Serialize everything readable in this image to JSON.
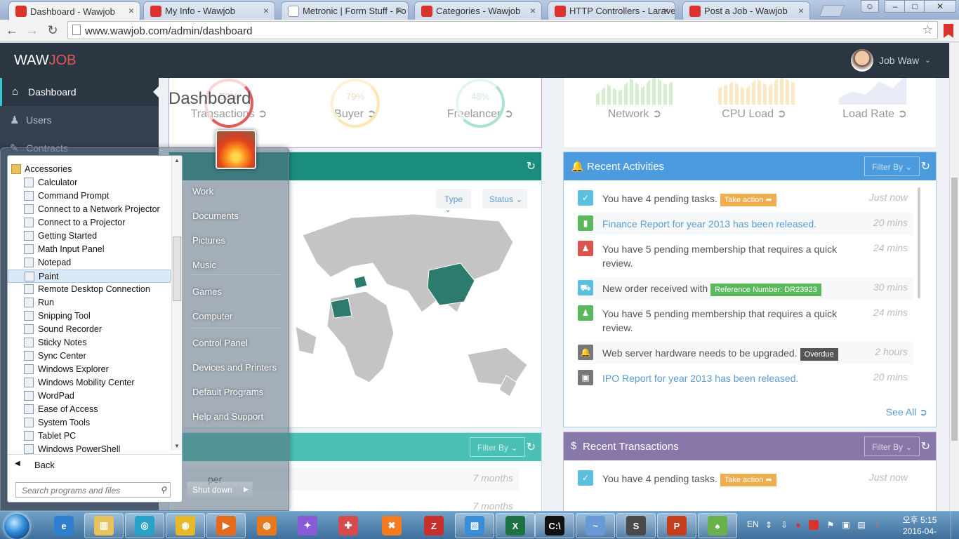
{
  "browser": {
    "tabs": [
      {
        "title": "Dashboard - Wawjob",
        "active": true
      },
      {
        "title": "My Info - Wawjob",
        "active": false
      },
      {
        "title": "Metronic | Form Stuff - Fo",
        "active": false
      },
      {
        "title": "Categories - Wawjob",
        "active": false
      },
      {
        "title": "HTTP Controllers - Laravel",
        "active": false
      },
      {
        "title": "Post a Job - Wawjob",
        "active": false
      }
    ],
    "url": "www.wawjob.com/admin/dashboard"
  },
  "app": {
    "logo_main": "WAW",
    "logo_accent": "JOB",
    "user_name": "Job Waw",
    "page_title": "Dashboard"
  },
  "sidebar": {
    "items": [
      {
        "label": "Dashboard",
        "icon": "home-icon",
        "active": true
      },
      {
        "label": "Users",
        "icon": "users-icon",
        "active": false
      },
      {
        "label": "Contracts",
        "icon": "contracts-icon",
        "active": false
      }
    ]
  },
  "stats_left": {
    "items": [
      {
        "value": "52%",
        "label": "Transactions"
      },
      {
        "value": "79%",
        "label": "Buyer"
      },
      {
        "value": "48%",
        "label": "Freelancer"
      }
    ]
  },
  "stats_right": {
    "items": [
      {
        "label": "Network"
      },
      {
        "label": "CPU Load"
      },
      {
        "label": "Load Rate"
      }
    ]
  },
  "map_portlet": {
    "type_label": "Type",
    "status_label": "Status"
  },
  "recent_activities": {
    "title": "Recent Activities",
    "filter_label": "Filter By",
    "see_all": "See All",
    "items": [
      {
        "text": "You have 4 pending tasks.",
        "badge": "Take action",
        "badge_color": "#f0ad4e",
        "time": "Just now",
        "color": "#5bc0de",
        "icon": "check-icon",
        "link": false
      },
      {
        "text": "Finance Report for year 2013 has been released.",
        "badge": "",
        "time": "20 mins",
        "color": "#5cb85c",
        "icon": "bar-chart-icon",
        "link": true
      },
      {
        "text": "You have 5 pending membership that requires a quick review.",
        "badge": "",
        "time": "24 mins",
        "color": "#d9534f",
        "icon": "user-icon",
        "link": false
      },
      {
        "text": "New order received with",
        "badge": "Reference Number: DR23923",
        "badge_color": "#5cb85c",
        "time": "30 mins",
        "color": "#5bc0de",
        "icon": "cart-icon",
        "link": false
      },
      {
        "text": "You have 5 pending membership that requires a quick review.",
        "badge": "",
        "time": "24 mins",
        "color": "#5cb85c",
        "icon": "user-icon",
        "link": false
      },
      {
        "text": "Web server hardware needs to be upgraded.",
        "badge": "Overdue",
        "badge_color": "#555555",
        "time": "2 hours",
        "color": "#777777",
        "icon": "bell-icon",
        "link": false
      },
      {
        "text": "IPO Report for year 2013 has been released.",
        "badge": "",
        "time": "20 mins",
        "color": "#777777",
        "icon": "briefcase-icon",
        "link": true
      }
    ]
  },
  "recent_jobs": {
    "filter_label": "Filter By",
    "items": [
      {
        "text": "per",
        "time": "7 months"
      },
      {
        "text": "",
        "time": "7 months"
      }
    ]
  },
  "recent_transactions": {
    "title": "Recent Transactions",
    "filter_label": "Filter By",
    "items": [
      {
        "text": "You have 4 pending tasks.",
        "badge": "Take action",
        "time": "Just now"
      }
    ]
  },
  "start_menu": {
    "programs": [
      {
        "label": "Accessories",
        "folder": true
      },
      {
        "label": "Calculator"
      },
      {
        "label": "Command Prompt"
      },
      {
        "label": "Connect to a Network Projector"
      },
      {
        "label": "Connect to a Projector"
      },
      {
        "label": "Getting Started"
      },
      {
        "label": "Math Input Panel"
      },
      {
        "label": "Notepad"
      },
      {
        "label": "Paint",
        "highlight": true
      },
      {
        "label": "Remote Desktop Connection"
      },
      {
        "label": "Run"
      },
      {
        "label": "Snipping Tool"
      },
      {
        "label": "Sound Recorder"
      },
      {
        "label": "Sticky Notes"
      },
      {
        "label": "Sync Center"
      },
      {
        "label": "Windows Explorer"
      },
      {
        "label": "Windows Mobility Center"
      },
      {
        "label": "WordPad"
      },
      {
        "label": "Ease of Access"
      },
      {
        "label": "System Tools"
      },
      {
        "label": "Tablet PC"
      },
      {
        "label": "Windows PowerShell"
      }
    ],
    "back_label": "Back",
    "search_placeholder": "Search programs and files",
    "right_links": [
      "Work",
      "Documents",
      "Pictures",
      "Music",
      "Games",
      "Computer",
      "Control Panel",
      "Devices and Printers",
      "Default Programs",
      "Help and Support"
    ],
    "shutdown_label": "Shut down"
  },
  "taskbar": {
    "apps": [
      "Internet Explorer",
      "Windows Explorer",
      "Media Player",
      "Chrome",
      "Media Player Classic",
      "Firefox",
      "App",
      "App",
      "XAMPP",
      "FileZilla",
      "Image Viewer",
      "Excel",
      "Command Prompt",
      "Dolphin",
      "Sublime Text",
      "PowerPoint",
      "Parrot"
    ],
    "language": "EN",
    "time": "오후 5:15",
    "date": "2016-04-13"
  }
}
